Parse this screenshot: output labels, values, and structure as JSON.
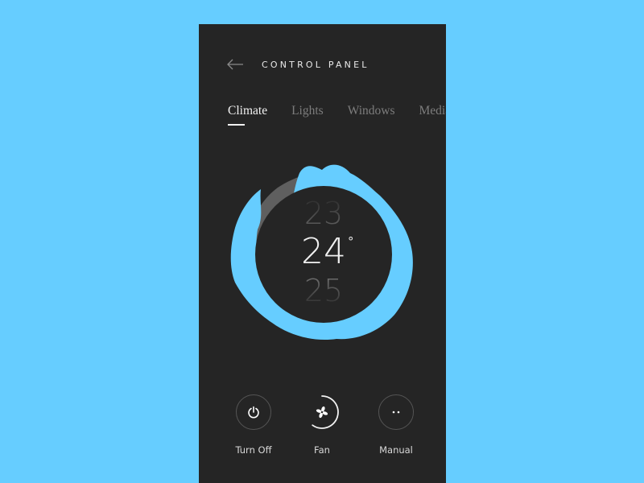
{
  "header": {
    "title": "CONTROL PANEL",
    "back_icon": "arrow-left-icon"
  },
  "tabs": [
    {
      "label": "Climate",
      "active": true
    },
    {
      "label": "Lights",
      "active": false
    },
    {
      "label": "Windows",
      "active": false
    },
    {
      "label": "Media",
      "active": false
    }
  ],
  "thermostat": {
    "previous": "23",
    "current": "24",
    "next": "25",
    "unit": "°"
  },
  "controls": [
    {
      "label": "Turn Off",
      "icon": "power-icon"
    },
    {
      "label": "Fan",
      "icon": "fan-icon",
      "progress": 0.6
    },
    {
      "label": "Manual",
      "icon": "dots-icon"
    }
  ],
  "colors": {
    "background": "#66cdff",
    "panel": "#252525",
    "accent": "#66cdff"
  }
}
